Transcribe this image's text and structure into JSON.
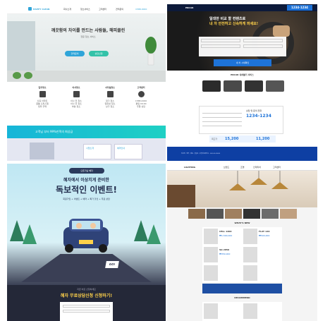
{
  "tile1": {
    "logo": "HAPPY CLEAN",
    "nav": [
      "회사소개",
      "청소서비스",
      "고객센터",
      "견적문의"
    ],
    "phone": "1588-0000",
    "hero_headline": "깨끗함의 차이를 만드는 사람들, 해피클린",
    "hero_sub": "전문 청소 서비스",
    "btn_primary": "견적문의",
    "btn_secondary": "상담신청",
    "services": [
      {
        "title": "입주청소",
        "lines": [
          "신축 아파트",
          "원룸 오피스텔",
          "빌라 주택"
        ]
      },
      {
        "title": "이사청소",
        "lines": [
          "이사 전 청소",
          "이사 후 청소",
          "부분 청소"
        ]
      },
      {
        "title": "사무실청소",
        "lines": [
          "정기 청소",
          "일회성 청소",
          "상가 청소"
        ]
      },
      {
        "title": "고객센터",
        "lines": [
          "1588-0000",
          "평일 09:00",
          "주말 상담"
        ]
      }
    ],
    "banner": "고객님 부터 99%만족의 최상급",
    "card1": "사업소개",
    "card2": "예약안내"
  },
  "tile2": {
    "logo": "ENCAR",
    "phone": "1234-1234",
    "hero_line1": "일대한 비교 할 컨텐츠로",
    "hero_line2": "내 차 안전하고 신속하게 파세요!",
    "form_btn": "내 차 시세확인",
    "section_title": "ENCAR 내차팔기 서비스",
    "consult_title": "상담 및 문의 전화",
    "consult_phone": "1234-1234",
    "price_label": "최고가",
    "price1": "15,200",
    "price2": "11,200",
    "footer": "상호명 : 엔카 | 대표 : 홍길동 | 사업자등록번호 : 000-00-00000"
  },
  "tile3": {
    "tag": "오픈기념 혜자",
    "title1": "혜자에서 이상치게 준비한",
    "title2": "독보적인 이벤트!",
    "sub": "회원가입 + 이벤트 + 예약 + 특가 할인 + 무료 상담",
    "badge": "GO!",
    "banner_sub": "지금 바로 신청하세요",
    "banner_title": "혜자 무료상담신청 신청하기!"
  },
  "tile4": {
    "logo": "LIGHTING",
    "nav": [
      "브랜드",
      "조명",
      "인테리어",
      "고객센터"
    ],
    "section": "WHAT'S NEW",
    "product1_name": "CELL 1200",
    "product1_price": "₩1,500,000",
    "product2_name": "FLAT 120",
    "product2_price": "₩500,000",
    "product3_name": "SQ 2850",
    "product3_price": "₩350,000",
    "bottom_section": "RECOMMEND"
  }
}
